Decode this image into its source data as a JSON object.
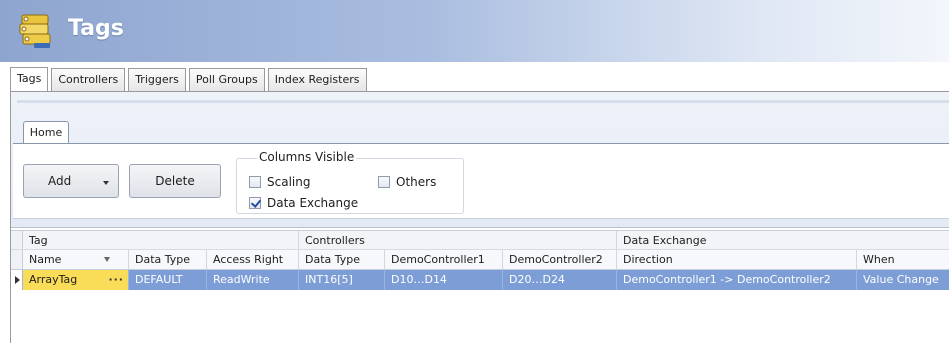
{
  "app": {
    "title": "Tags"
  },
  "main_tabs": [
    {
      "label": "Tags",
      "active": true
    },
    {
      "label": "Controllers",
      "active": false
    },
    {
      "label": "Triggers",
      "active": false
    },
    {
      "label": "Poll Groups",
      "active": false
    },
    {
      "label": "Index Registers",
      "active": false
    }
  ],
  "ribbon": {
    "tab": "Home",
    "add_label": "Add",
    "delete_label": "Delete",
    "columns_visible": {
      "title": "Columns Visible",
      "scaling": {
        "label": "Scaling",
        "checked": false
      },
      "others": {
        "label": "Others",
        "checked": false
      },
      "data_exchange": {
        "label": "Data Exchange",
        "checked": true
      }
    }
  },
  "grid": {
    "group_headers": {
      "tag": "Tag",
      "controllers": "Controllers",
      "data_exchange": "Data Exchange"
    },
    "columns": [
      "Name",
      "Data Type",
      "Access Right",
      "Data Type",
      "DemoController1",
      "DemoController2",
      "Direction",
      "When"
    ],
    "rows": [
      {
        "name": "ArrayTag",
        "ellipsis": "···",
        "data_type": "DEFAULT",
        "access_right": "ReadWrite",
        "controller_data_type": "INT16[5]",
        "demo_controller1": "D10…D14",
        "demo_controller2": "D20…D24",
        "direction": "DemoController1 -> DemoController2",
        "when": "Value Change"
      }
    ]
  },
  "colors": {
    "selected_row": "#7d9dd6",
    "name_cell": "#f9dc57",
    "banner": "#8ea5cf"
  }
}
